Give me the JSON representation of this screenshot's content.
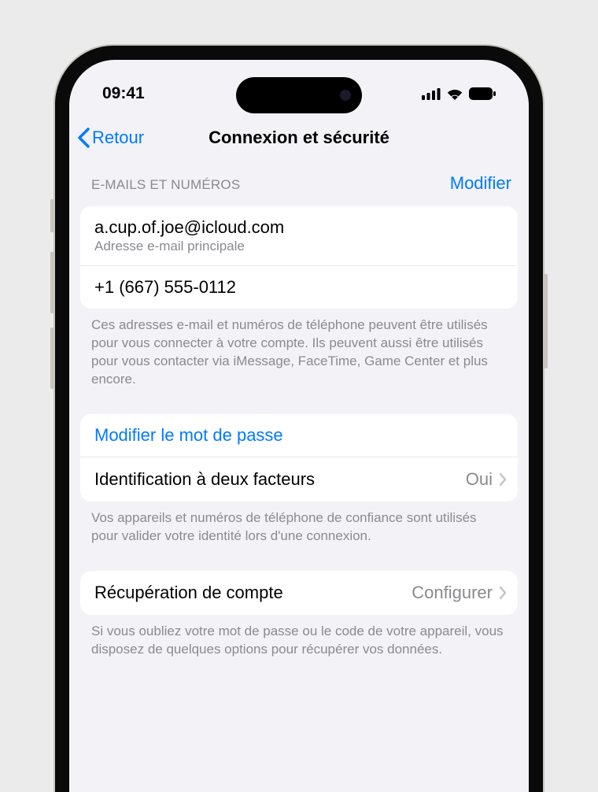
{
  "status": {
    "time": "09:41"
  },
  "nav": {
    "back": "Retour",
    "title": "Connexion et sécurité"
  },
  "emails_section": {
    "header": "E-MAILS ET NUMÉROS",
    "edit": "Modifier",
    "primary_email": "a.cup.of.joe@icloud.com",
    "primary_email_label": "Adresse e-mail principale",
    "phone": "+1 (667) 555-0112",
    "footer": "Ces adresses e-mail et numéros de téléphone peuvent être utilisés pour vous connecter à votre compte. Ils peuvent aussi être utilisés pour vous contacter via iMessage, FaceTime, Game Center et plus encore."
  },
  "password_section": {
    "change_password": "Modifier le mot de passe",
    "two_factor_label": "Identification à deux facteurs",
    "two_factor_value": "Oui",
    "footer": "Vos appareils et numéros de téléphone de confiance sont utilisés pour valider votre identité lors d'une connexion."
  },
  "recovery_section": {
    "label": "Récupération de compte",
    "value": "Configurer",
    "footer": "Si vous oubliez votre mot de passe ou le code de votre appareil, vous disposez de quelques options pour récupérer vos données."
  }
}
